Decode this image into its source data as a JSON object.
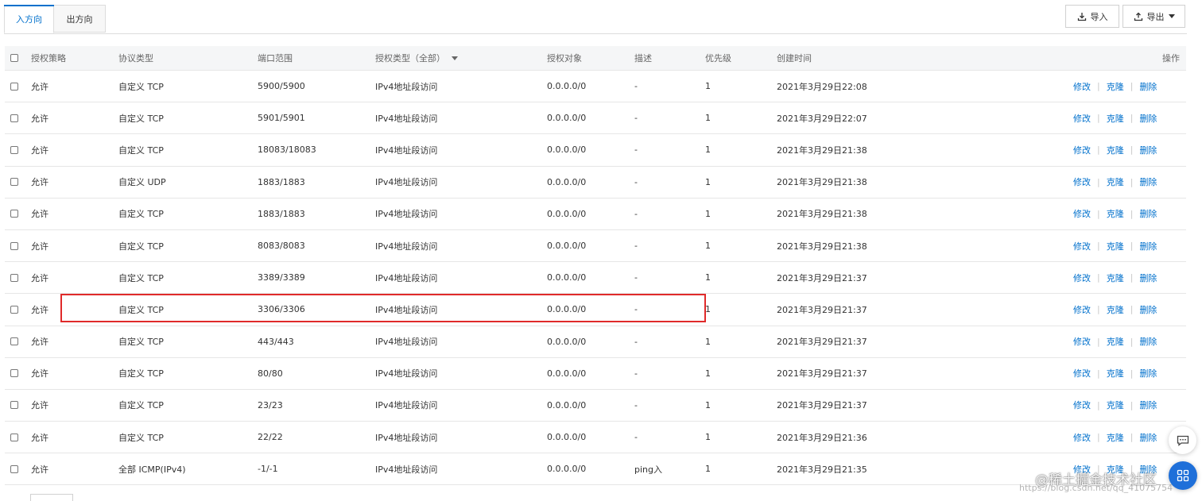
{
  "tabs": [
    {
      "label": "入方向",
      "active": true
    },
    {
      "label": "出方向",
      "active": false
    }
  ],
  "toolbar": {
    "import_label": "导入",
    "export_label": "导出"
  },
  "table": {
    "headers": {
      "policy": "授权策略",
      "protocol": "协议类型",
      "port_range": "端口范围",
      "auth_type": "授权类型（全部）",
      "auth_target": "授权对象",
      "description": "描述",
      "priority": "优先级",
      "created": "创建时间",
      "actions": "操作"
    },
    "actions": {
      "edit": "修改",
      "clone": "克隆",
      "delete": "删除"
    },
    "rows": [
      {
        "policy": "允许",
        "protocol": "自定义 TCP",
        "port_range": "5900/5900",
        "auth_type": "IPv4地址段访问",
        "auth_target": "0.0.0.0/0",
        "description": "-",
        "priority": "1",
        "created": "2021年3月29日22:08"
      },
      {
        "policy": "允许",
        "protocol": "自定义 TCP",
        "port_range": "5901/5901",
        "auth_type": "IPv4地址段访问",
        "auth_target": "0.0.0.0/0",
        "description": "-",
        "priority": "1",
        "created": "2021年3月29日22:07"
      },
      {
        "policy": "允许",
        "protocol": "自定义 TCP",
        "port_range": "18083/18083",
        "auth_type": "IPv4地址段访问",
        "auth_target": "0.0.0.0/0",
        "description": "-",
        "priority": "1",
        "created": "2021年3月29日21:38"
      },
      {
        "policy": "允许",
        "protocol": "自定义 UDP",
        "port_range": "1883/1883",
        "auth_type": "IPv4地址段访问",
        "auth_target": "0.0.0.0/0",
        "description": "-",
        "priority": "1",
        "created": "2021年3月29日21:38"
      },
      {
        "policy": "允许",
        "protocol": "自定义 TCP",
        "port_range": "1883/1883",
        "auth_type": "IPv4地址段访问",
        "auth_target": "0.0.0.0/0",
        "description": "-",
        "priority": "1",
        "created": "2021年3月29日21:38"
      },
      {
        "policy": "允许",
        "protocol": "自定义 TCP",
        "port_range": "8083/8083",
        "auth_type": "IPv4地址段访问",
        "auth_target": "0.0.0.0/0",
        "description": "-",
        "priority": "1",
        "created": "2021年3月29日21:38"
      },
      {
        "policy": "允许",
        "protocol": "自定义 TCP",
        "port_range": "3389/3389",
        "auth_type": "IPv4地址段访问",
        "auth_target": "0.0.0.0/0",
        "description": "-",
        "priority": "1",
        "created": "2021年3月29日21:37"
      },
      {
        "policy": "允许",
        "protocol": "自定义 TCP",
        "port_range": "3306/3306",
        "auth_type": "IPv4地址段访问",
        "auth_target": "0.0.0.0/0",
        "description": "-",
        "priority": "1",
        "created": "2021年3月29日21:37"
      },
      {
        "policy": "允许",
        "protocol": "自定义 TCP",
        "port_range": "443/443",
        "auth_type": "IPv4地址段访问",
        "auth_target": "0.0.0.0/0",
        "description": "-",
        "priority": "1",
        "created": "2021年3月29日21:37"
      },
      {
        "policy": "允许",
        "protocol": "自定义 TCP",
        "port_range": "80/80",
        "auth_type": "IPv4地址段访问",
        "auth_target": "0.0.0.0/0",
        "description": "-",
        "priority": "1",
        "created": "2021年3月29日21:37"
      },
      {
        "policy": "允许",
        "protocol": "自定义 TCP",
        "port_range": "23/23",
        "auth_type": "IPv4地址段访问",
        "auth_target": "0.0.0.0/0",
        "description": "-",
        "priority": "1",
        "created": "2021年3月29日21:37"
      },
      {
        "policy": "允许",
        "protocol": "自定义 TCP",
        "port_range": "22/22",
        "auth_type": "IPv4地址段访问",
        "auth_target": "0.0.0.0/0",
        "description": "-",
        "priority": "1",
        "created": "2021年3月29日21:36"
      },
      {
        "policy": "允许",
        "protocol": "全部 ICMP(IPv4)",
        "port_range": "-1/-1",
        "auth_type": "IPv4地址段访问",
        "auth_target": "0.0.0.0/0",
        "description": "ping入",
        "priority": "1",
        "created": "2021年3月29日21:35"
      }
    ]
  },
  "watermark": {
    "line1": "@稀土掘金技术社区",
    "line2": "https://blog.csdn.net/qq_41075754"
  },
  "colors": {
    "accent": "#0070cc",
    "highlight": "#e02a2a",
    "header_bg": "#f5f6f7",
    "fab_blue": "#1e6fd9"
  },
  "icons": {
    "import": "download-icon",
    "export": "upload-icon",
    "export_caret": "caret-down-icon",
    "filter": "filter-caret-icon",
    "chat": "chat-icon",
    "app": "app-grid-icon"
  }
}
